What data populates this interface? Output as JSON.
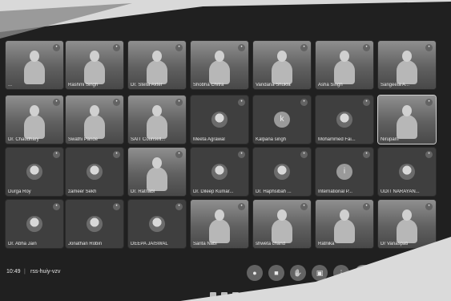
{
  "meeting": {
    "time": "10:49",
    "separator": "|",
    "code": "rss-huiy-vzv"
  },
  "participants": [
    {
      "name": "...",
      "kind": "video"
    },
    {
      "name": "Rashmi Singh",
      "kind": "video"
    },
    {
      "name": "Dr. Stella Akter",
      "kind": "video"
    },
    {
      "name": "Shobha Chitra",
      "kind": "video"
    },
    {
      "name": "Vandana Shukla",
      "kind": "video"
    },
    {
      "name": "Asha Singh",
      "kind": "video"
    },
    {
      "name": "Sangeeta A...",
      "kind": "video"
    },
    {
      "name": "Dr. Chaudhary",
      "kind": "video"
    },
    {
      "name": "Swathi Pande",
      "kind": "video"
    },
    {
      "name": "SAIT Counsell...",
      "kind": "video"
    },
    {
      "name": "Meeta Agrawal",
      "kind": "avatar-image"
    },
    {
      "name": "Kalpana singh",
      "kind": "avatar-letter",
      "initial": "k"
    },
    {
      "name": "Mohammed Fai...",
      "kind": "avatar-image"
    },
    {
      "name": "Nirupam",
      "kind": "video"
    },
    {
      "name": "Durga Roy",
      "kind": "avatar-image"
    },
    {
      "name": "zameer Sekh",
      "kind": "avatar-image"
    },
    {
      "name": "Dr. Ratnabl",
      "kind": "video"
    },
    {
      "name": "Dr. Dileep Kumar...",
      "kind": "avatar-image"
    },
    {
      "name": "Dr. Haphsibah ...",
      "kind": "avatar-image"
    },
    {
      "name": "International P...",
      "kind": "avatar-letter",
      "initial": "i"
    },
    {
      "name": "UDIT NARAYAN...",
      "kind": "avatar-image"
    },
    {
      "name": "Dr. Abha Jain",
      "kind": "avatar-image"
    },
    {
      "name": "Jonathan Robin",
      "kind": "avatar-image"
    },
    {
      "name": "DEEPA JAISWAL",
      "kind": "avatar-image"
    },
    {
      "name": "Sarita Nabi",
      "kind": "video"
    },
    {
      "name": "shweta chand",
      "kind": "video"
    },
    {
      "name": "Ratnika",
      "kind": "video"
    },
    {
      "name": "Dr Vanaspati",
      "kind": "video"
    }
  ],
  "controls": [
    {
      "label": "mic",
      "glyph": "●"
    },
    {
      "label": "camera",
      "glyph": "■"
    },
    {
      "label": "raise-hand",
      "glyph": "✋"
    },
    {
      "label": "present",
      "glyph": "▣"
    },
    {
      "label": "more",
      "glyph": "⋮"
    },
    {
      "label": "leave-call",
      "glyph": "☎"
    }
  ],
  "colors": {
    "tile": "#3c4043",
    "background": "#1f2024",
    "end_call": "#8a8a8a"
  }
}
